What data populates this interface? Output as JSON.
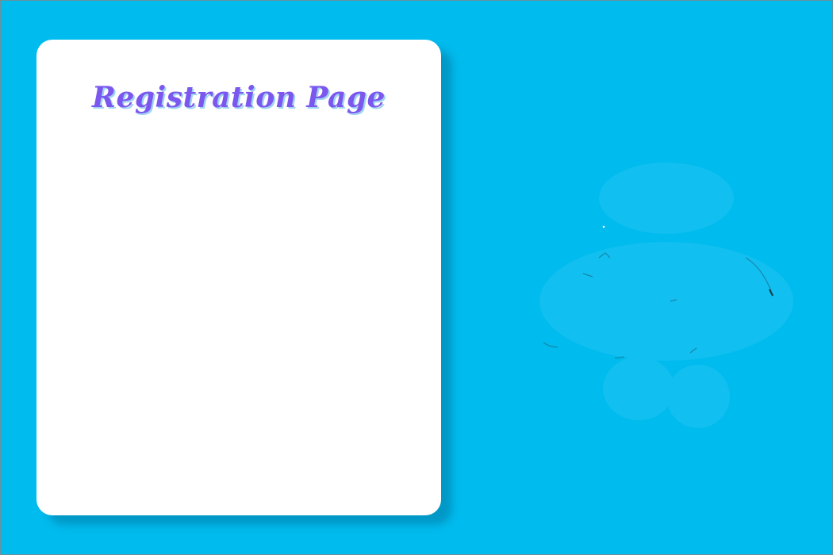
{
  "page": {
    "title": "Registration Page"
  },
  "colors": {
    "background": "#00bbee",
    "card": "#ffffff",
    "title": "#7b57ef",
    "title_shadow": "#9fd4f0"
  },
  "decorations": {
    "right_illustration": "faint-figure-icon"
  }
}
